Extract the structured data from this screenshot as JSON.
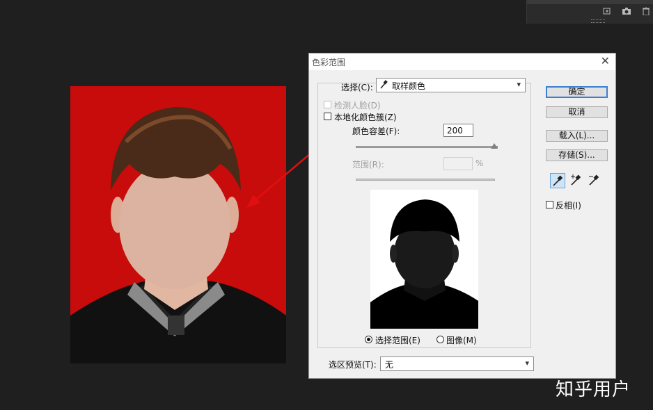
{
  "window": {
    "title": "色彩范围"
  },
  "select": {
    "label": "选择(C):",
    "value": "取样颜色"
  },
  "detect_faces": {
    "label": "检测人脸(D)",
    "checked": false,
    "disabled": true
  },
  "localized": {
    "label": "本地化颜色簇(Z)",
    "checked": false
  },
  "fuzziness": {
    "label": "颜色容差(F):",
    "value": "200",
    "slider_fraction": 1.0
  },
  "range": {
    "label": "范围(R):",
    "value": "",
    "unit": "%",
    "disabled": true
  },
  "view_options": [
    {
      "label": "选择范围(E)",
      "selected": true
    },
    {
      "label": "图像(M)",
      "selected": false
    }
  ],
  "selection_preview": {
    "label": "选区预览(T):",
    "value": "无"
  },
  "buttons": {
    "ok": "确定",
    "cancel": "取消",
    "load": "载入(L)...",
    "save": "存储(S)..."
  },
  "invert": {
    "label": "反相(I)",
    "checked": false
  },
  "tools": [
    "eyedropper-icon",
    "eyedropper-plus-icon",
    "eyedropper-minus-icon"
  ],
  "watermark": "知乎用户",
  "colors": {
    "photo_background": "#c80b0b",
    "arrow": "#e01010",
    "default_button_border": "#3b7fd0"
  }
}
